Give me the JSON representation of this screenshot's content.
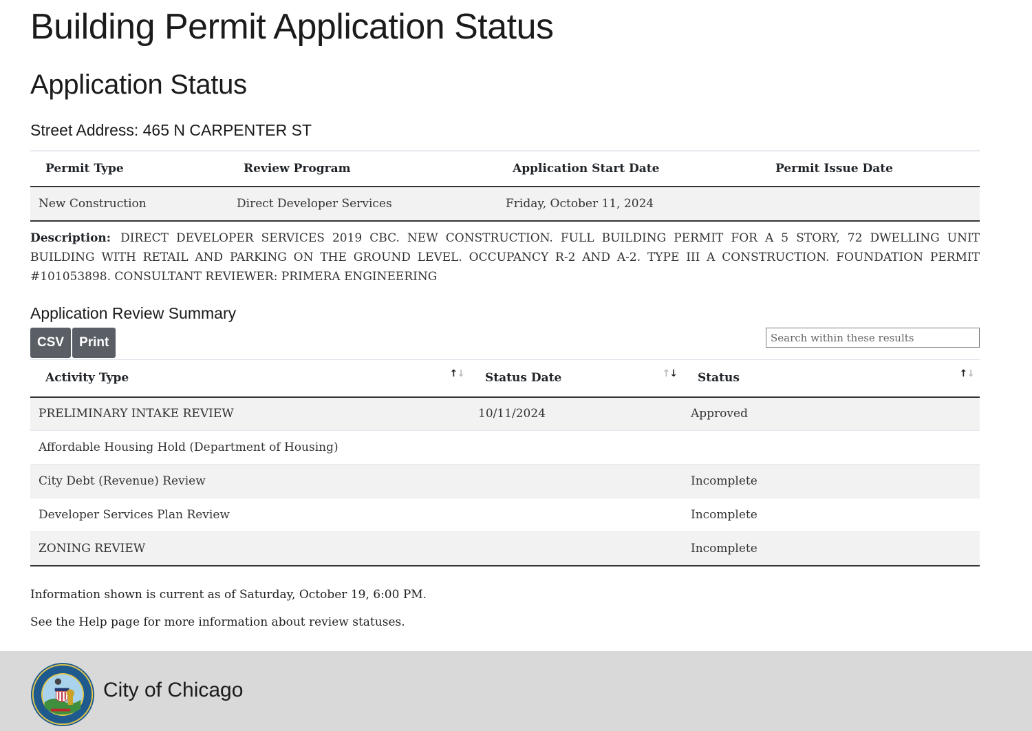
{
  "page": {
    "title": "Building Permit Application Status",
    "section_title": "Application Status",
    "address_label": "Street Address:",
    "address_value": "465 N CARPENTER ST"
  },
  "permit_table": {
    "headers": [
      "Permit Type",
      "Review Program",
      "Application Start Date",
      "Permit Issue Date"
    ],
    "row": {
      "permit_type": "New Construction",
      "review_program": "Direct Developer Services",
      "application_start_date": "Friday, October 11, 2024",
      "permit_issue_date": ""
    }
  },
  "description": {
    "label": "Description:",
    "text": "DIRECT DEVELOPER SERVICES 2019 CBC. NEW CONSTRUCTION. FULL BUILDING PERMIT FOR A 5 STORY, 72 DWELLING UNIT BUILDING WITH RETAIL AND PARKING ON THE GROUND LEVEL. OCCUPANCY R-2 AND A-2. TYPE III A CONSTRUCTION. FOUNDATION PERMIT #101053898. CONSULTANT REVIEWER: PRIMERA ENGINEERING"
  },
  "review_summary": {
    "title": "Application Review Summary",
    "buttons": {
      "csv": "CSV",
      "print": "Print"
    },
    "search_placeholder": "Search within these results",
    "headers": [
      {
        "label": "Activity Type",
        "sort_icon": "sort-up-down-icon",
        "active": "up"
      },
      {
        "label": "Status Date",
        "sort_icon": "sort-up-down-icon",
        "active": "down"
      },
      {
        "label": "Status",
        "sort_icon": "sort-up-down-icon",
        "active": "up"
      }
    ],
    "rows": [
      {
        "activity_type": "PRELIMINARY INTAKE REVIEW",
        "status_date": "10/11/2024",
        "status": "Approved"
      },
      {
        "activity_type": "Affordable Housing Hold (Department of Housing)",
        "status_date": "",
        "status": ""
      },
      {
        "activity_type": "City Debt (Revenue) Review",
        "status_date": "",
        "status": "Incomplete"
      },
      {
        "activity_type": "Developer Services Plan Review",
        "status_date": "",
        "status": "Incomplete"
      },
      {
        "activity_type": "ZONING REVIEW",
        "status_date": "",
        "status": "Incomplete"
      }
    ]
  },
  "notes": {
    "current_as_of": "Information shown is current as of Saturday, October 19, 6:00 PM.",
    "help_prefix": "See the ",
    "help_link": "Help",
    "help_suffix": " page for more information about review statuses."
  },
  "footer": {
    "name": "City of Chicago",
    "seal_icon": "city-seal-icon"
  },
  "colors": {
    "button_bg": "#5a5f66",
    "footer_bg": "#d9d9d9",
    "row_stripe": "#f2f2f2"
  }
}
